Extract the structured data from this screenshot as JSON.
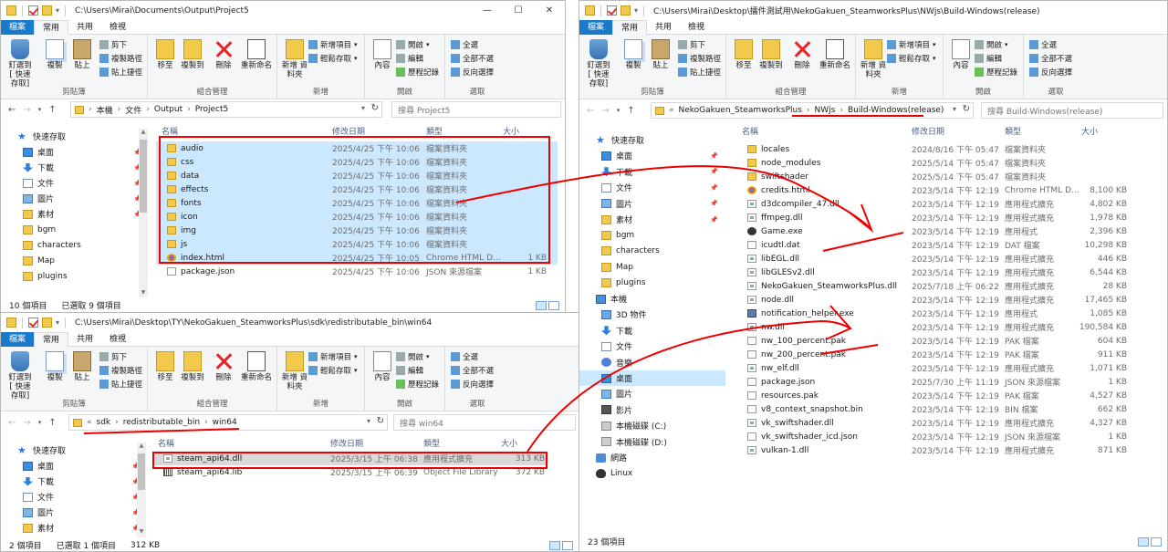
{
  "ribbon_labels": {
    "pin": "釘選到 [ 快速存取]",
    "copy": "複製",
    "paste": "貼上",
    "cut": "剪下",
    "copy_path": "複製路徑",
    "paste_shortcut": "貼上捷徑",
    "move_to": "移至",
    "copy_to": "複製到",
    "delete": "刪除",
    "rename": "重新命名",
    "new_folder": "新增 資料夾",
    "new_item": "新增項目",
    "easy_access": "輕鬆存取",
    "properties": "內容",
    "open": "開啟",
    "edit": "編輯",
    "history": "歷程記錄",
    "select_all": "全選",
    "select_none": "全部不選",
    "invert": "反向選擇",
    "grp_clipboard": "剪貼簿",
    "grp_organize": "組合管理",
    "grp_new": "新增",
    "grp_open": "開啟",
    "grp_select": "選取"
  },
  "tabs": {
    "file": "檔案",
    "home": "常用",
    "share": "共用",
    "view": "檢視"
  },
  "columns": {
    "name": "名稱",
    "date": "修改日期",
    "type": "類型",
    "size": "大小"
  },
  "win1": {
    "title": "C:\\Users\\Mirai\\Documents\\Output\\Project5",
    "crumbs": [
      "本機",
      "文件",
      "Output",
      "Project5"
    ],
    "search": "搜尋 Project5",
    "sidebar": [
      {
        "label": "快速存取",
        "icon": "star"
      },
      {
        "label": "桌面",
        "icon": "blue",
        "pin": true
      },
      {
        "label": "下載",
        "icon": "dl",
        "pin": true
      },
      {
        "label": "文件",
        "icon": "doc",
        "pin": true
      },
      {
        "label": "圖片",
        "icon": "pic",
        "pin": true
      },
      {
        "label": "素材",
        "icon": "fold",
        "pin": true
      },
      {
        "label": "bgm",
        "icon": "fold"
      },
      {
        "label": "characters",
        "icon": "fold"
      },
      {
        "label": "Map",
        "icon": "fold"
      },
      {
        "label": "plugins",
        "icon": "fold"
      }
    ],
    "files": [
      {
        "name": "audio",
        "date": "2025/4/25 下午 10:06",
        "type": "檔案資料夾",
        "size": "",
        "icon": "fold",
        "sel": true
      },
      {
        "name": "css",
        "date": "2025/4/25 下午 10:06",
        "type": "檔案資料夾",
        "size": "",
        "icon": "fold",
        "sel": true
      },
      {
        "name": "data",
        "date": "2025/4/25 下午 10:06",
        "type": "檔案資料夾",
        "size": "",
        "icon": "fold",
        "sel": true
      },
      {
        "name": "effects",
        "date": "2025/4/25 下午 10:06",
        "type": "檔案資料夾",
        "size": "",
        "icon": "fold",
        "sel": true
      },
      {
        "name": "fonts",
        "date": "2025/4/25 下午 10:06",
        "type": "檔案資料夾",
        "size": "",
        "icon": "fold",
        "sel": true
      },
      {
        "name": "icon",
        "date": "2025/4/25 下午 10:06",
        "type": "檔案資料夾",
        "size": "",
        "icon": "fold",
        "sel": true
      },
      {
        "name": "img",
        "date": "2025/4/25 下午 10:06",
        "type": "檔案資料夾",
        "size": "",
        "icon": "fold",
        "sel": true
      },
      {
        "name": "js",
        "date": "2025/4/25 下午 10:06",
        "type": "檔案資料夾",
        "size": "",
        "icon": "fold",
        "sel": true
      },
      {
        "name": "index.html",
        "date": "2025/4/25 下午 10:05",
        "type": "Chrome HTML D...",
        "size": "1 KB",
        "icon": "chrome",
        "sel": true
      },
      {
        "name": "package.json",
        "date": "2025/4/25 下午 10:06",
        "type": "JSON 來源檔案",
        "size": "1 KB",
        "icon": "doc",
        "sel": false
      }
    ],
    "status_count": "10 個項目",
    "status_sel": "已選取 9 個項目"
  },
  "win2": {
    "title": "C:\\Users\\Mirai\\Desktop\\TY\\NekoGakuen_SteamworksPlus\\sdk\\redistributable_bin\\win64",
    "crumbs": [
      "sdk",
      "redistributable_bin",
      "win64"
    ],
    "search": "搜尋 win64",
    "sidebar": [
      {
        "label": "快速存取",
        "icon": "star"
      },
      {
        "label": "桌面",
        "icon": "blue",
        "pin": true
      },
      {
        "label": "下載",
        "icon": "dl",
        "pin": true
      },
      {
        "label": "文件",
        "icon": "doc",
        "pin": true
      },
      {
        "label": "圖片",
        "icon": "pic",
        "pin": true
      },
      {
        "label": "素材",
        "icon": "fold",
        "pin": true
      }
    ],
    "files": [
      {
        "name": "steam_api64.dll",
        "date": "2025/3/15 上午 06:38",
        "type": "應用程式擴充",
        "size": "313 KB",
        "icon": "cog",
        "sel": true
      },
      {
        "name": "steam_api64.lib",
        "date": "2025/3/15 上午 06:39",
        "type": "Object File Library",
        "size": "372 KB",
        "icon": "lib",
        "sel": false
      }
    ],
    "status_count": "2 個項目",
    "status_sel": "已選取 1 個項目",
    "status_size": "312 KB"
  },
  "win3": {
    "title": "C:\\Users\\Mirai\\Desktop\\擂件測試用\\NekoGakuen_SteamworksPlus\\NWjs\\Build-Windows(release)",
    "crumbs": [
      "NekoGakuen_SteamworksPlus",
      "NWjs",
      "Build-Windows(release)"
    ],
    "search": "搜尋 Build-Windows(release)",
    "sidebar": [
      {
        "label": "快速存取",
        "icon": "star"
      },
      {
        "label": "桌面",
        "icon": "blue",
        "pin": true
      },
      {
        "label": "下載",
        "icon": "dl",
        "pin": true
      },
      {
        "label": "文件",
        "icon": "doc",
        "pin": true
      },
      {
        "label": "圖片",
        "icon": "pic",
        "pin": true
      },
      {
        "label": "素材",
        "icon": "fold",
        "pin": true
      },
      {
        "label": "bgm",
        "icon": "fold"
      },
      {
        "label": "characters",
        "icon": "fold"
      },
      {
        "label": "Map",
        "icon": "fold"
      },
      {
        "label": "plugins",
        "icon": "fold"
      },
      {
        "label": "本機",
        "icon": "pc"
      },
      {
        "label": "3D 物件",
        "icon": "cube"
      },
      {
        "label": "下載",
        "icon": "dl"
      },
      {
        "label": "文件",
        "icon": "doc"
      },
      {
        "label": "音樂",
        "icon": "music"
      },
      {
        "label": "桌面",
        "icon": "blue",
        "sel": true
      },
      {
        "label": "圖片",
        "icon": "pic"
      },
      {
        "label": "影片",
        "icon": "vid"
      },
      {
        "label": "本機磁碟 (C:)",
        "icon": "drive"
      },
      {
        "label": "本機磁碟 (D:)",
        "icon": "drive"
      },
      {
        "label": "網路",
        "icon": "net"
      },
      {
        "label": "Linux",
        "icon": "tux"
      }
    ],
    "files": [
      {
        "name": "locales",
        "date": "2024/8/16 下午 05:47",
        "type": "檔案資料夾",
        "size": "",
        "icon": "fold"
      },
      {
        "name": "node_modules",
        "date": "2025/5/14 下午 05:47",
        "type": "檔案資料夾",
        "size": "",
        "icon": "fold"
      },
      {
        "name": "swiftshader",
        "date": "2025/5/14 下午 05:47",
        "type": "檔案資料夾",
        "size": "",
        "icon": "fold"
      },
      {
        "name": "credits.html",
        "date": "2023/5/14 下午 12:19",
        "type": "Chrome HTML D...",
        "size": "8,100 KB",
        "icon": "chrome"
      },
      {
        "name": "d3dcompiler_47.dll",
        "date": "2023/5/14 下午 12:19",
        "type": "應用程式擴充",
        "size": "4,802 KB",
        "icon": "cog"
      },
      {
        "name": "ffmpeg.dll",
        "date": "2023/5/14 下午 12:19",
        "type": "應用程式擴充",
        "size": "1,978 KB",
        "icon": "cog"
      },
      {
        "name": "Game.exe",
        "date": "2023/5/14 下午 12:19",
        "type": "應用程式",
        "size": "2,396 KB",
        "icon": "game"
      },
      {
        "name": "icudtl.dat",
        "date": "2023/5/14 下午 12:19",
        "type": "DAT 檔案",
        "size": "10,298 KB",
        "icon": "doc"
      },
      {
        "name": "libEGL.dll",
        "date": "2023/5/14 下午 12:19",
        "type": "應用程式擴充",
        "size": "446 KB",
        "icon": "cog"
      },
      {
        "name": "libGLESv2.dll",
        "date": "2023/5/14 下午 12:19",
        "type": "應用程式擴充",
        "size": "6,544 KB",
        "icon": "cog"
      },
      {
        "name": "NekoGakuen_SteamworksPlus.dll",
        "date": "2025/7/18 上午 06:22",
        "type": "應用程式擴充",
        "size": "28 KB",
        "icon": "cog"
      },
      {
        "name": "node.dll",
        "date": "2023/5/14 下午 12:19",
        "type": "應用程式擴充",
        "size": "17,465 KB",
        "icon": "cog"
      },
      {
        "name": "notification_helper.exe",
        "date": "2023/5/14 下午 12:19",
        "type": "應用程式",
        "size": "1,085 KB",
        "icon": "exe"
      },
      {
        "name": "nw.dll",
        "date": "2023/5/14 下午 12:19",
        "type": "應用程式擴充",
        "size": "190,584 KB",
        "icon": "cog"
      },
      {
        "name": "nw_100_percent.pak",
        "date": "2023/5/14 下午 12:19",
        "type": "PAK 檔案",
        "size": "604 KB",
        "icon": "doc"
      },
      {
        "name": "nw_200_percent.pak",
        "date": "2023/5/14 下午 12:19",
        "type": "PAK 檔案",
        "size": "911 KB",
        "icon": "doc"
      },
      {
        "name": "nw_elf.dll",
        "date": "2023/5/14 下午 12:19",
        "type": "應用程式擴充",
        "size": "1,071 KB",
        "icon": "cog"
      },
      {
        "name": "package.json",
        "date": "2025/7/30 上午 11:19",
        "type": "JSON 來源檔案",
        "size": "1 KB",
        "icon": "doc"
      },
      {
        "name": "resources.pak",
        "date": "2023/5/14 下午 12:19",
        "type": "PAK 檔案",
        "size": "4,527 KB",
        "icon": "doc"
      },
      {
        "name": "v8_context_snapshot.bin",
        "date": "2023/5/14 下午 12:19",
        "type": "BIN 檔案",
        "size": "662 KB",
        "icon": "doc"
      },
      {
        "name": "vk_swiftshader.dll",
        "date": "2023/5/14 下午 12:19",
        "type": "應用程式擴充",
        "size": "4,327 KB",
        "icon": "cog"
      },
      {
        "name": "vk_swiftshader_icd.json",
        "date": "2023/5/14 下午 12:19",
        "type": "JSON 來源檔案",
        "size": "1 KB",
        "icon": "doc"
      },
      {
        "name": "vulkan-1.dll",
        "date": "2023/5/14 下午 12:19",
        "type": "應用程式擴充",
        "size": "871 KB",
        "icon": "cog"
      }
    ],
    "status_count": "23 個項目"
  },
  "colors": {
    "accent": "#1979ca",
    "selection": "#cce8ff",
    "annotation": "#e00000"
  }
}
